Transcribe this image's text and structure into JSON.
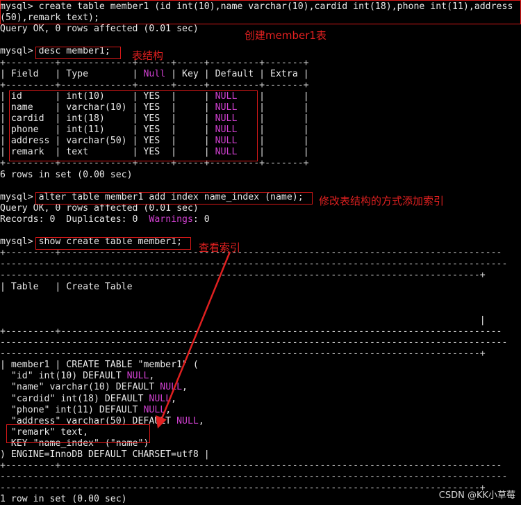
{
  "terminal": {
    "lines": [
      "mysql> create table member1 (id int(10),name varchar(10),cardid int(18),phone int(11),address",
      "(50),remark text);",
      "Query OK, 0 rows affected (0.01 sec)",
      "",
      "mysql> desc member1;",
      "+---------+-------------+------+-----+---------+-------+",
      "| Field   | Type        | Null | Key | Default | Extra |",
      "+---------+-------------+------+-----+---------+-------+",
      "| id      | int(10)     | YES  |     | NULL    |       |",
      "| name    | varchar(10) | YES  |     | NULL    |       |",
      "| cardid  | int(18)     | YES  |     | NULL    |       |",
      "| phone   | int(11)     | YES  |     | NULL    |       |",
      "| address | varchar(50) | YES  |     | NULL    |       |",
      "| remark  | text        | YES  |     | NULL    |       |",
      "+---------+-------------+------+-----+---------+-------+",
      "6 rows in set (0.00 sec)",
      "",
      "mysql> alter table member1 add index name_index (name);",
      "Query OK, 0 rows affected (0.01 sec)",
      "Records: 0  Duplicates: 0  Warnings: 0",
      "",
      "mysql> show create table member1;",
      "+---------+--------------------------------------------------------------------------------",
      "--------------------------------------------------------------------------------------------",
      "---------------------------------------------------------------------------------------+",
      "| Table   | Create Table",
      "",
      "",
      "                                                                                       |",
      "+---------+--------------------------------------------------------------------------------",
      "--------------------------------------------------------------------------------------------",
      "---------------------------------------------------------------------------------------+",
      "| member1 | CREATE TABLE \"member1\" (",
      "  \"id\" int(10) DEFAULT NULL,",
      "  \"name\" varchar(10) DEFAULT NULL,",
      "  \"cardid\" int(18) DEFAULT NULL,",
      "  \"phone\" int(11) DEFAULT NULL,",
      "  \"address\" varchar(50) DEFAULT NULL,",
      "  \"remark\" text,",
      "  KEY \"name_index\" (\"name\")",
      ") ENGINE=InnoDB DEFAULT CHARSET=utf8 |",
      "+---------+--------------------------------------------------------------------------------",
      "--------------------------------------------------------------------------------------------",
      "---------------------------------------------------------------------------------------+",
      "1 row in set (0.00 sec)"
    ],
    "highlight_words": [
      "NULL",
      "Null",
      "Warnings"
    ],
    "highlight_color": "#d040d0"
  },
  "annotations": {
    "create_note": "创建member1表",
    "desc_note": "表结构",
    "alter_note": "修改表结构的方式添加索引",
    "show_note": "查看索引"
  },
  "watermark": "CSDN @KK小草莓",
  "colors": {
    "background": "#000000",
    "text": "#e8e8e8",
    "annotation": "#e02020",
    "keyword": "#d040d0"
  }
}
